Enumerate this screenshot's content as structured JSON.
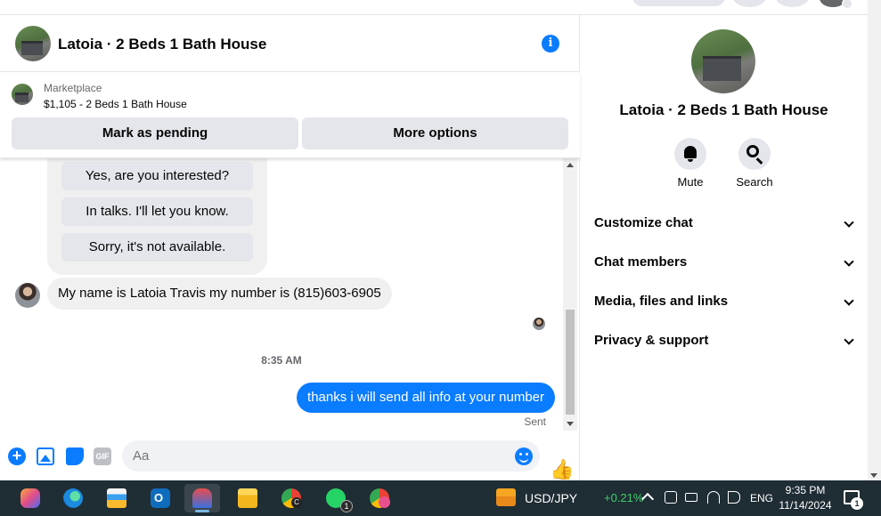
{
  "chat": {
    "title": "Latoia · 2 Beds 1 Bath House",
    "marketplace_label": "Marketplace",
    "listing": "$1,105 - 2 Beds 1 Bath House",
    "mark_pending_label": "Mark as pending",
    "more_options_label": "More options",
    "quick_replies": [
      "Yes, are you interested?",
      "In talks. I'll let you know.",
      "Sorry, it's not available."
    ],
    "incoming_message": "My name is Latoia Travis my number is (815)603-6905",
    "timestamp": "8:35 AM",
    "outgoing_message": "thanks i will send all info at your number",
    "sent_label": "Sent",
    "input_placeholder": "Aa",
    "info_glyph": "i",
    "plus_glyph": "+",
    "gif_glyph": "GIF",
    "like_glyph": "👍"
  },
  "right_panel": {
    "title": "Latoia · 2 Beds 1 Bath House",
    "mute_label": "Mute",
    "search_label": "Search",
    "sections": [
      "Customize chat",
      "Chat members",
      "Media, files and links",
      "Privacy & support"
    ]
  },
  "taskbar": {
    "ticker_name": "USD/JPY",
    "ticker_change": "+0.21%",
    "language": "ENG",
    "time": "9:35 PM",
    "date": "11/14/2024",
    "whatsapp_badge": "1",
    "chrome_badge": "C",
    "notification_badge": "1",
    "apps": [
      "copilot",
      "edge",
      "microsoft-store",
      "outlook",
      "tool",
      "file-explorer",
      "chrome",
      "whatsapp",
      "chrome-profile"
    ]
  },
  "colors": {
    "accent": "#0a7cff",
    "taskbar": "#1f2d34",
    "bubble_incoming": "#f0f0f0",
    "ticker_positive": "#3ecf6a"
  }
}
